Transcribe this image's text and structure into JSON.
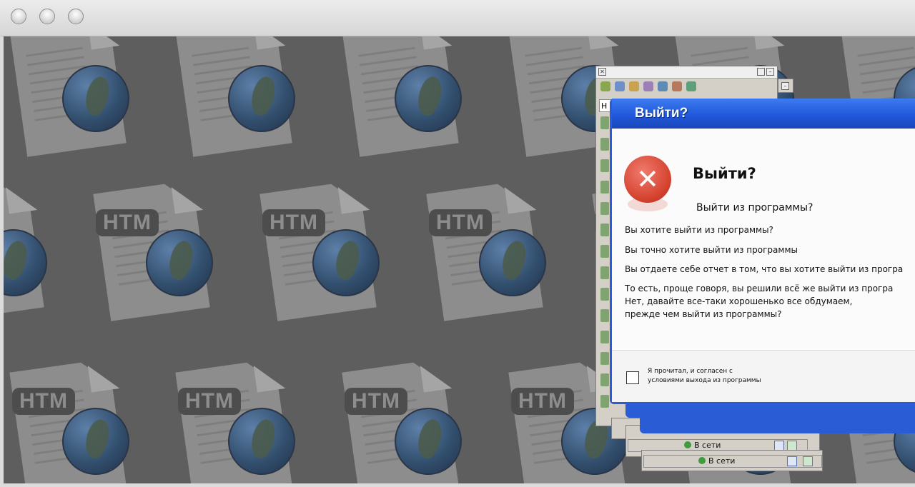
{
  "window": {
    "controls": [
      "close",
      "minimize",
      "zoom"
    ]
  },
  "background": {
    "tile_label": "HTM",
    "colors": {
      "backdrop": "#5e5e5e"
    }
  },
  "contact_list": {
    "search_prefix": "H",
    "status_rows": [
      {
        "label": "В сети"
      },
      {
        "label": "В сети"
      }
    ]
  },
  "exit_dialog": {
    "title": "Выйти?",
    "heading": "Выйти?",
    "question": "Выйти из программы?",
    "lines": [
      "Вы хотите выйти из программы?",
      "Вы точно хотите выйти из программы",
      "Вы отдаете себе отчет в том, что вы хотите выйти из програ",
      "То есть, проще говоря,  вы решили всё же выйти из програ",
      "Нет, давайте все-таки хорошенько все обдумаем,",
      "прежде чем  выйти из программы?"
    ],
    "checkbox_label_line1": "Я прочитал, и согласен с",
    "checkbox_label_line2": "условиями выхода из программы",
    "checkbox_checked": false,
    "colors": {
      "title_bar": "#2a5cd6",
      "error_icon": "#d5432f"
    }
  }
}
